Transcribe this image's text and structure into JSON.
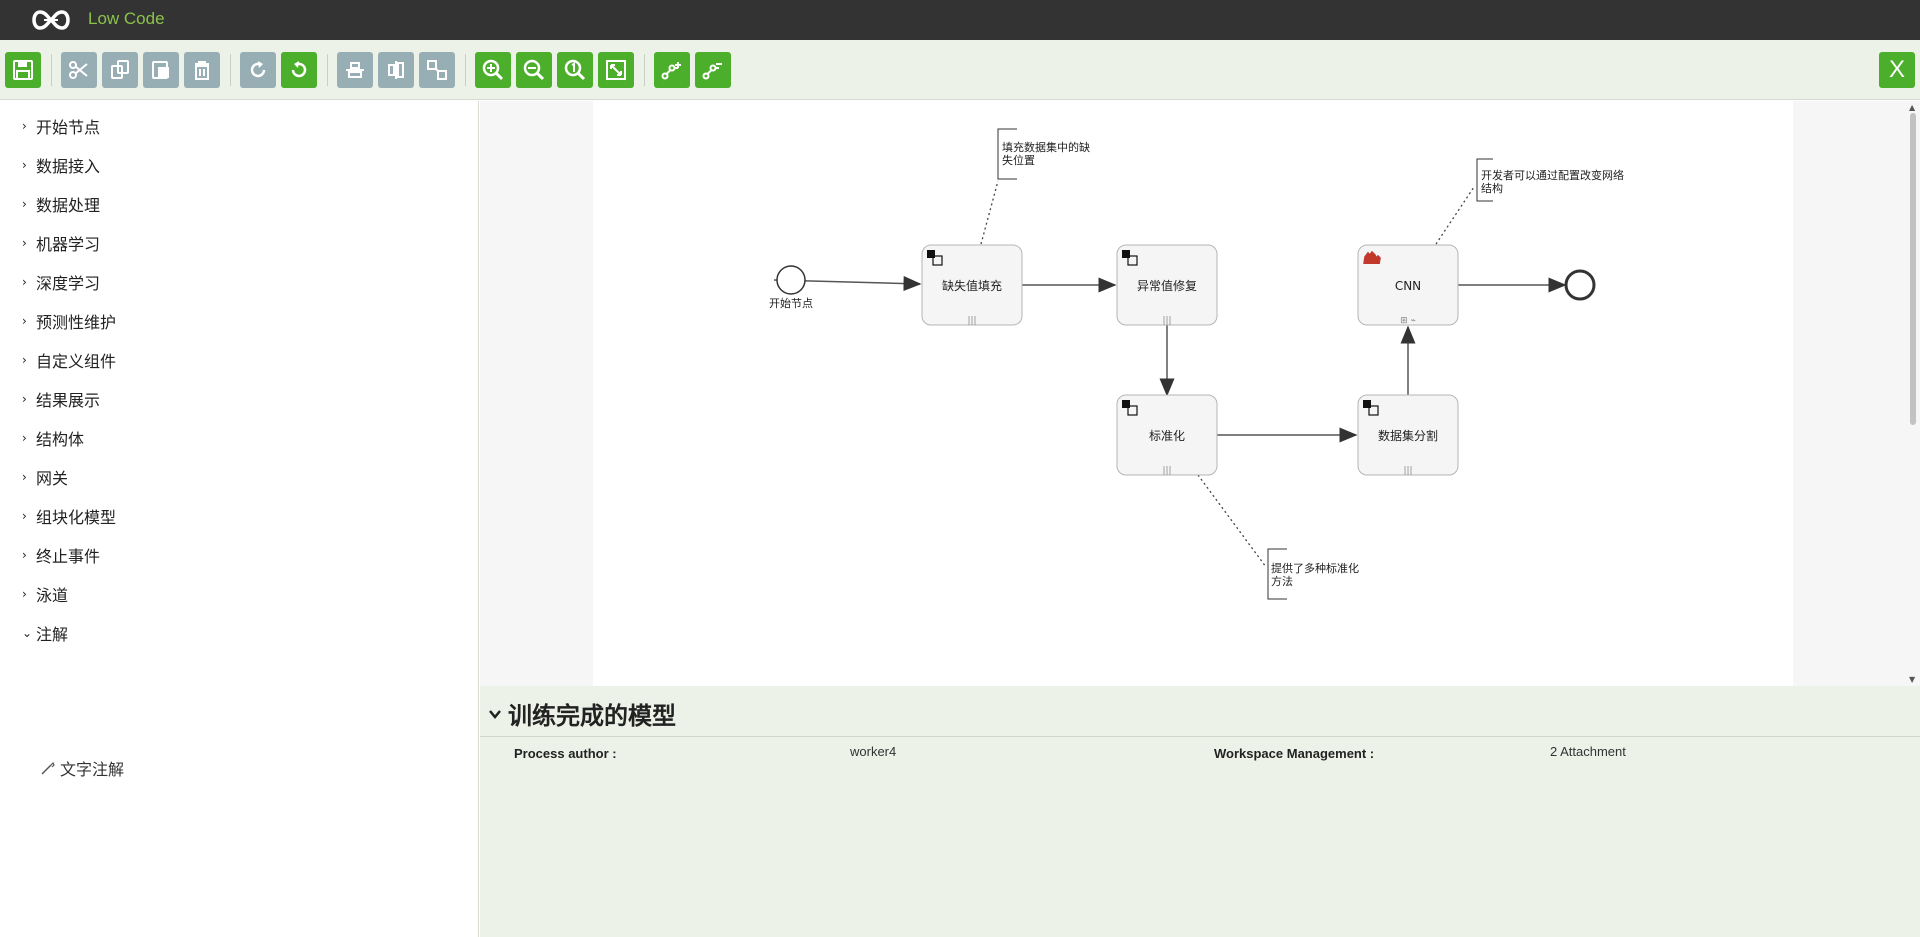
{
  "app": {
    "title": "Low Code"
  },
  "toolbar": {
    "buttons": [
      {
        "icon": "save-icon"
      },
      {
        "icon": "cut-icon"
      },
      {
        "icon": "copy-icon"
      },
      {
        "icon": "paste-icon"
      },
      {
        "icon": "delete-icon"
      },
      {
        "icon": "redo-icon"
      },
      {
        "icon": "undo-icon"
      },
      {
        "icon": "align-vertical-icon"
      },
      {
        "icon": "align-horizontal-icon"
      },
      {
        "icon": "same-size-icon"
      },
      {
        "icon": "zoom-in-icon"
      },
      {
        "icon": "zoom-out-icon"
      },
      {
        "icon": "zoom-actual-icon"
      },
      {
        "icon": "zoom-fit-icon"
      },
      {
        "icon": "add-bendpoint-icon"
      },
      {
        "icon": "remove-bendpoint-icon"
      }
    ],
    "close_label": "X",
    "colors": {
      "active": "#4caf2b",
      "disabled": "#98aeb5"
    }
  },
  "palette": {
    "groups": [
      "开始节点",
      "数据接入",
      "数据处理",
      "机器学习",
      "深度学习",
      "预测性维护",
      "自定义组件",
      "结果展示",
      "结构体",
      "网关",
      "组块化模型",
      "终止事件",
      "泳道",
      "注解"
    ],
    "expanded": "注解",
    "expanded_items": [
      "文字注解"
    ]
  },
  "diagram": {
    "start_label": "开始节点",
    "tasks": {
      "fill": "缺失值填充",
      "outlier": "异常值修复",
      "normalize": "标准化",
      "split": "数据集分割",
      "cnn": "CNN"
    },
    "annotations": {
      "fill_line1": "填充数据集中的缺",
      "fill_line2": "失位置",
      "cnn_line1": "开发者可以通过配置改变网络",
      "cnn_line2": "结构",
      "norm_line1": "提供了多种标准化",
      "norm_line2": "方法"
    }
  },
  "properties": {
    "title": "训练完成的模型",
    "author_label": "Process author :",
    "author_value": "worker4",
    "workspace_label": "Workspace Management :",
    "workspace_value": "2 Attachment"
  }
}
